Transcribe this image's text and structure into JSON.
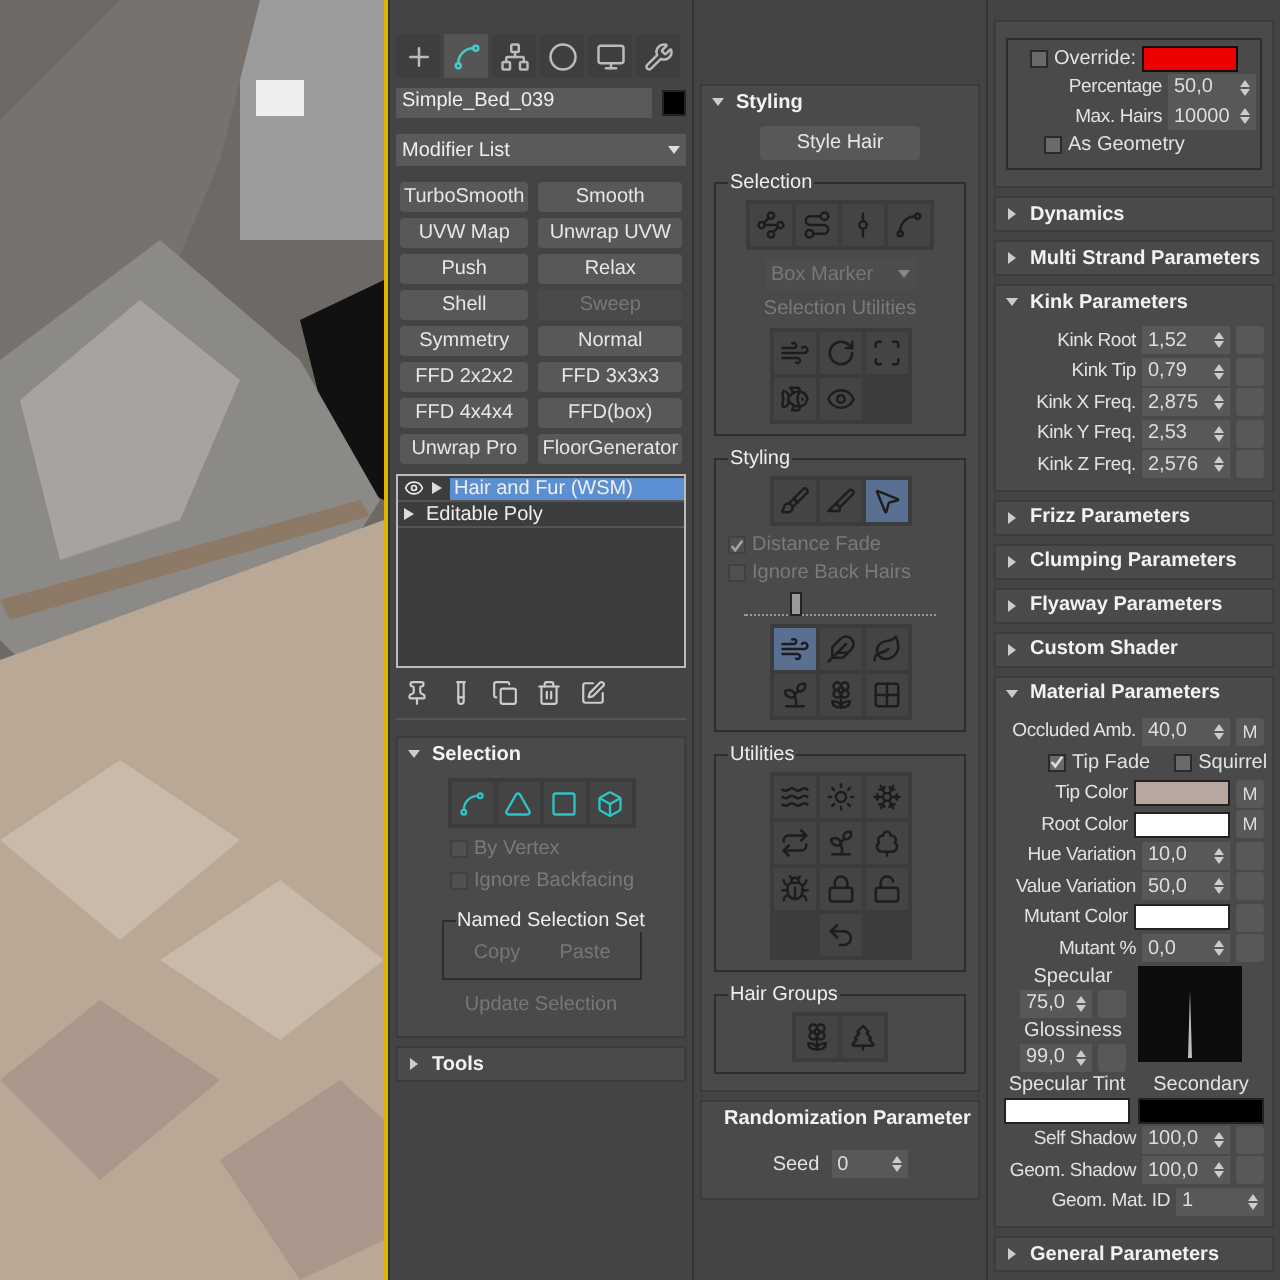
{
  "command_panel": {
    "tabs": [
      {
        "selected": false
      },
      {
        "selected": true
      },
      {
        "selected": false
      },
      {
        "selected": false
      },
      {
        "selected": false
      },
      {
        "selected": false
      }
    ],
    "object_name": "Simple_Bed_039",
    "object_swatch": {
      "color": "#000000"
    },
    "modifier_list": "Modifier List",
    "modifier_buttons": [
      {
        "label": "TurboSmooth",
        "disabled": false
      },
      {
        "label": "Smooth",
        "disabled": false
      },
      {
        "label": "UVW Map",
        "disabled": false
      },
      {
        "label": "Unwrap UVW",
        "disabled": false
      },
      {
        "label": "Push",
        "disabled": false
      },
      {
        "label": "Relax",
        "disabled": false
      },
      {
        "label": "Shell",
        "disabled": false
      },
      {
        "label": "Sweep",
        "disabled": true
      },
      {
        "label": "Symmetry",
        "disabled": false
      },
      {
        "label": "Normal",
        "disabled": false
      },
      {
        "label": "FFD 2x2x2",
        "disabled": false
      },
      {
        "label": "FFD 3x3x3",
        "disabled": false
      },
      {
        "label": "FFD 4x4x4",
        "disabled": false
      },
      {
        "label": "FFD(box)",
        "disabled": false
      },
      {
        "label": "Unwrap Pro",
        "disabled": false
      },
      {
        "label": "FloorGenerator",
        "disabled": false
      }
    ],
    "stack": [
      {
        "label": "Hair and Fur (WSM)",
        "selected": true,
        "eye": true
      },
      {
        "label": "Editable Poly",
        "selected": false,
        "eye": false
      }
    ],
    "selection_rollout": {
      "title": "Selection",
      "expanded": true,
      "checks": [
        {
          "label": "By Vertex",
          "checked": false,
          "disabled": true
        },
        {
          "label": "Ignore Backfacing",
          "checked": false,
          "disabled": true
        }
      ],
      "group_title": "Named Selection Set",
      "group_buttons": [
        {
          "label": "Copy",
          "disabled": true
        },
        {
          "label": "Paste",
          "disabled": true
        }
      ],
      "update_button": {
        "label": "Update Selection",
        "disabled": true
      }
    },
    "tools_rollout": {
      "title": "Tools",
      "expanded": false
    }
  },
  "styling_rollout": {
    "title": "Styling",
    "expanded": true,
    "style_button": "Style Hair",
    "selection_group": {
      "title": "Selection",
      "dropdown": "Box Marker",
      "utilities_label": "Selection Utilities"
    },
    "styling_group": {
      "title": "Styling",
      "tools": [
        {
          "selected": false
        },
        {
          "selected": false
        },
        {
          "selected": true
        }
      ],
      "checks": [
        {
          "label": "Distance Fade",
          "checked": true,
          "disabled": true
        },
        {
          "label": "Ignore Back Hairs",
          "checked": false,
          "disabled": true
        }
      ],
      "brush_size": {
        "level": 0.27
      },
      "brushes": [
        {
          "selected": true
        },
        {
          "selected": false
        },
        {
          "selected": false
        },
        {
          "selected": false
        },
        {
          "selected": false
        },
        {
          "selected": false
        }
      ]
    },
    "utilities_group": {
      "title": "Utilities"
    },
    "hair_groups": {
      "title": "Hair Groups"
    }
  },
  "randomization_rollout": {
    "title": "Randomization Parameter",
    "expanded": true,
    "seed_label": "Seed",
    "seed": "0"
  },
  "parameters": {
    "display_hairs": [
      {
        "kind": "check_color",
        "label": "Override:",
        "checked": false,
        "color": "#ee0000"
      },
      {
        "kind": "spinner",
        "label": "Percentage",
        "value": "50,0",
        "map_button": false
      },
      {
        "kind": "spinner",
        "label": "Max. Hairs",
        "value": "10000",
        "map_button": false
      },
      {
        "kind": "check",
        "label": "As Geometry",
        "checked": false
      }
    ],
    "rollouts": [
      {
        "title": "Dynamics",
        "expanded": false
      },
      {
        "title": "Multi Strand Parameters",
        "expanded": false
      },
      {
        "title": "Kink Parameters",
        "expanded": true,
        "rows": [
          {
            "kind": "spinner",
            "label": "Kink Root",
            "value": "1,52",
            "map_button": true
          },
          {
            "kind": "spinner",
            "label": "Kink Tip",
            "value": "0,79",
            "map_button": true
          },
          {
            "kind": "spinner",
            "label": "Kink X Freq.",
            "value": "2,875",
            "map_button": true
          },
          {
            "kind": "spinner",
            "label": "Kink Y Freq.",
            "value": "2,53",
            "map_button": true
          },
          {
            "kind": "spinner",
            "label": "Kink Z Freq.",
            "value": "2,576",
            "map_button": true
          }
        ]
      },
      {
        "title": "Frizz Parameters",
        "expanded": false
      },
      {
        "title": "Clumping Parameters",
        "expanded": false
      },
      {
        "title": "Flyaway Parameters",
        "expanded": false
      },
      {
        "title": "Custom Shader",
        "expanded": false
      },
      {
        "title": "Material Parameters",
        "expanded": true,
        "rows": [
          {
            "kind": "spinner",
            "label": "Occluded Amb.",
            "value": "40,0",
            "map_button": true,
            "map_label": "M"
          },
          {
            "kind": "checks",
            "items": [
              {
                "label": "Tip Fade",
                "checked": true
              },
              {
                "label": "Squirrel",
                "checked": false
              }
            ]
          },
          {
            "kind": "color",
            "label": "Tip Color",
            "color": "#b8a79f",
            "map_button": true,
            "map_label": "M"
          },
          {
            "kind": "color",
            "label": "Root Color",
            "color": "#ffffff",
            "map_button": true,
            "map_label": "M"
          },
          {
            "kind": "spinner",
            "label": "Hue Variation",
            "value": "10,0",
            "map_button": true
          },
          {
            "kind": "spinner",
            "label": "Value Variation",
            "value": "50,0",
            "map_button": true
          },
          {
            "kind": "color",
            "label": "Mutant Color",
            "color": "#ffffff",
            "map_button": true
          },
          {
            "kind": "spinner",
            "label": "Mutant %",
            "value": "0,0",
            "map_button": true
          },
          {
            "kind": "specular",
            "items": [
              {
                "label": "Specular",
                "value": "75,0"
              },
              {
                "label": "Glossiness",
                "value": "99,0"
              }
            ]
          },
          {
            "kind": "tints",
            "items": [
              {
                "label": "Specular Tint",
                "color": "#ffffff"
              },
              {
                "label": "Secondary",
                "color": "#000000"
              }
            ]
          },
          {
            "kind": "spinner",
            "label": "Self Shadow",
            "value": "100,0",
            "map_button": true
          },
          {
            "kind": "spinner",
            "label": "Geom. Shadow",
            "value": "100,0",
            "map_button": true
          },
          {
            "kind": "spinner",
            "label": "Geom. Mat. ID",
            "value": "1",
            "map_button": false
          }
        ]
      },
      {
        "title": "General Parameters",
        "expanded": false
      }
    ]
  }
}
